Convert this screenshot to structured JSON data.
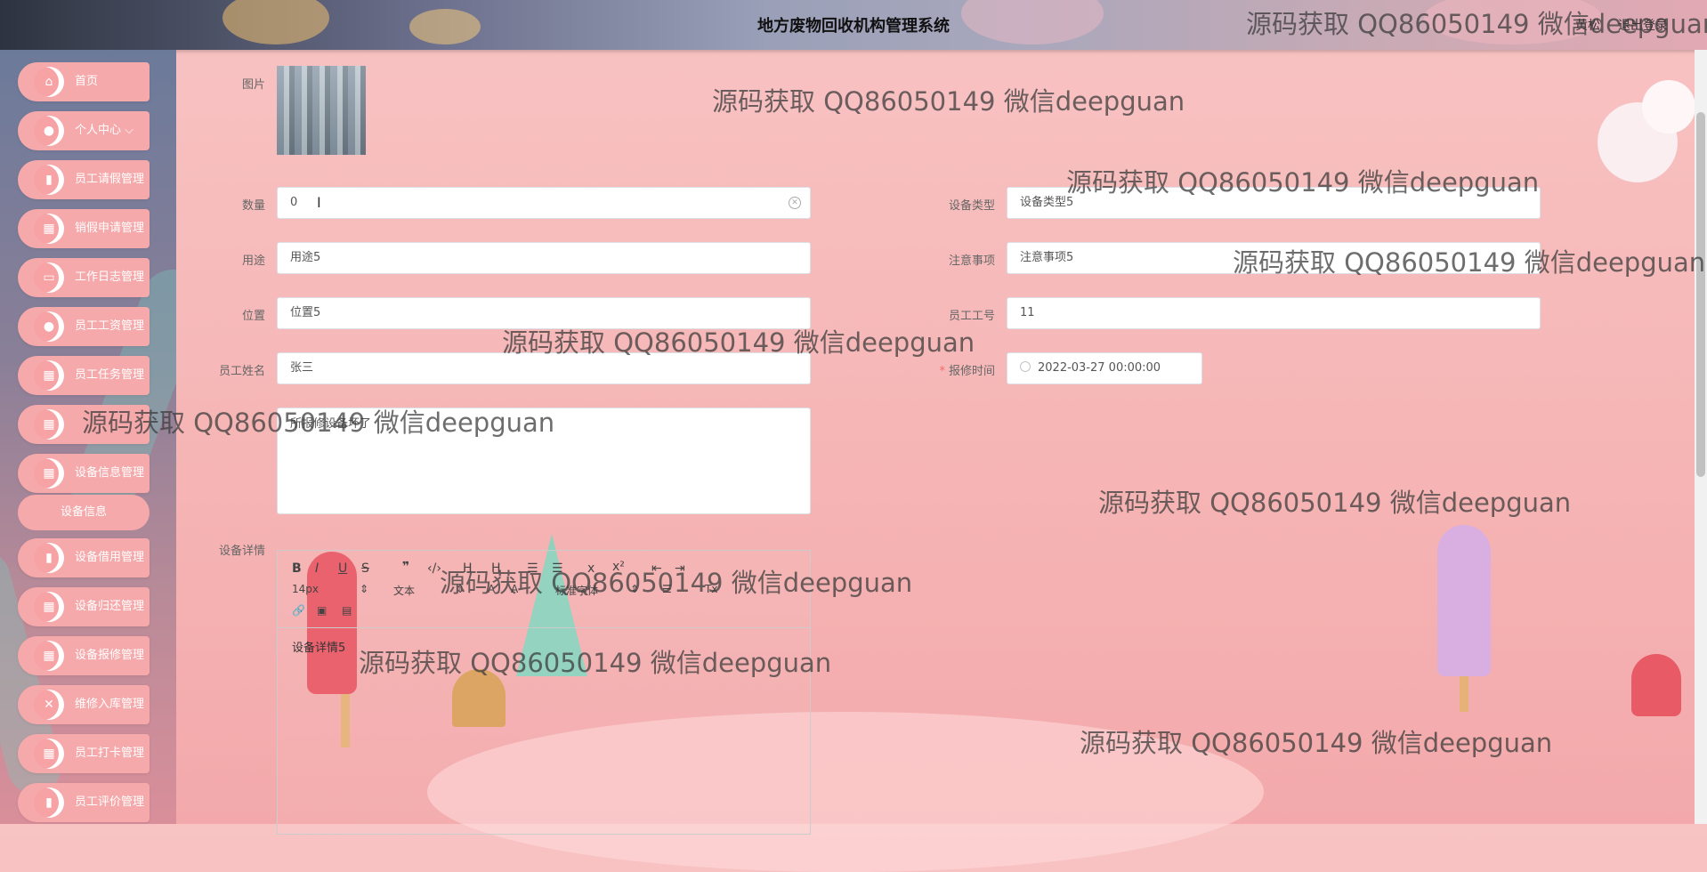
{
  "header": {
    "title": "地方废物回收机构管理系统",
    "user": "黄松",
    "logout": "退出登录"
  },
  "sidebar": {
    "items": [
      {
        "label": "首页",
        "icon": "home-icon"
      },
      {
        "label": "个人中心",
        "icon": "user-icon"
      },
      {
        "label": "员工请假管理",
        "icon": "clipboard-icon"
      },
      {
        "label": "销假申请管理",
        "icon": "grid-icon"
      },
      {
        "label": "工作日志管理",
        "icon": "monitor-icon"
      },
      {
        "label": "员工工资管理",
        "icon": "user-icon"
      },
      {
        "label": "员工任务管理",
        "icon": "grid-icon"
      },
      {
        "label": "",
        "icon": "grid-icon"
      },
      {
        "label": "设备信息管理",
        "icon": "grid-icon"
      },
      {
        "label": "设备借用管理",
        "icon": "clipboard-icon"
      },
      {
        "label": "设备归还管理",
        "icon": "grid-icon"
      },
      {
        "label": "设备报修管理",
        "icon": "grid-icon"
      },
      {
        "label": "维修入库管理",
        "icon": "tools-icon"
      },
      {
        "label": "员工打卡管理",
        "icon": "grid-icon"
      },
      {
        "label": "员工评价管理",
        "icon": "clipboard-icon"
      }
    ],
    "submenu_label": "设备信息",
    "chevron": "⌵"
  },
  "form": {
    "image_label": "图片",
    "quantity_label": "数量",
    "quantity_value": "0",
    "device_type_label": "设备类型",
    "device_type_value": "设备类型5",
    "usage_label": "用途",
    "usage_value": "用途5",
    "notes_label": "注意事项",
    "notes_value": "注意事项5",
    "location_label": "位置",
    "location_value": "位置5",
    "employee_no_label": "员工工号",
    "employee_no_value": "11",
    "employee_name_label": "员工姓名",
    "employee_name_value": "张三",
    "report_time_label": "报修时间",
    "report_time_value": "2022-03-27 00:00:00",
    "fault_text": "所报修设备坏了",
    "details_label": "设备详情",
    "details_content": "设备详情5"
  },
  "editor_toolbar": {
    "font_size": "14px",
    "text_style": "文本",
    "font_family": "标准字体"
  },
  "watermark": "源码获取 QQ86050149 微信deepguan"
}
